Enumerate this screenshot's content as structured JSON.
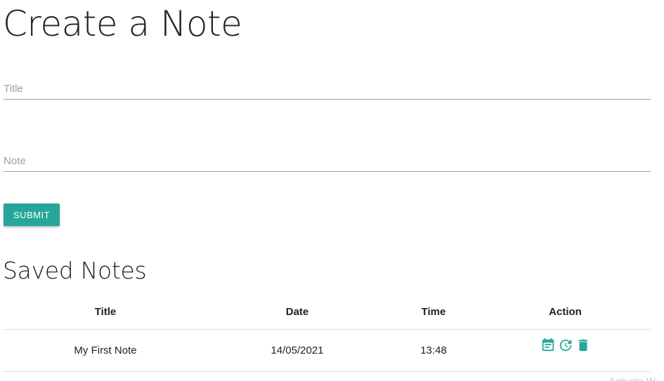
{
  "header": {
    "title": "Create a Note"
  },
  "form": {
    "title_placeholder": "Title",
    "title_value": "",
    "note_placeholder": "Note",
    "note_value": "",
    "submit_label": "SUBMIT"
  },
  "saved": {
    "heading": "Saved Notes",
    "columns": [
      "Title",
      "Date",
      "Time",
      "Action"
    ],
    "rows": [
      {
        "title": "My First Note",
        "date": "14/05/2021",
        "time": "13:48",
        "actions": [
          "view-note-icon",
          "update-icon",
          "delete-icon"
        ]
      }
    ]
  },
  "footer": {
    "watermark": "Activate W"
  },
  "colors": {
    "accent": "#26a69a",
    "text": "#222222",
    "placeholder": "#9e9e9e",
    "divider": "#e0e0e0"
  }
}
